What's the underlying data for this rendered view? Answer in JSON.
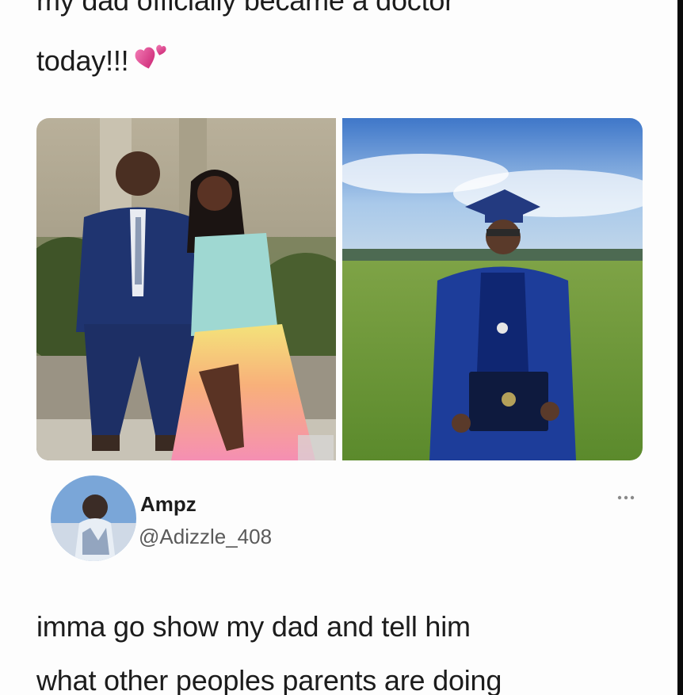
{
  "post": {
    "line1": "my dad officially became a doctor",
    "line2": "today!!!",
    "emoji": "two-hearts-emoji"
  },
  "photos": {
    "left": "father-and-daughter-photo",
    "right": "graduate-in-cap-and-gown-photo"
  },
  "reply": {
    "display_name": "Ampz",
    "handle": "@Adizzle_408",
    "menu": "more-options-icon",
    "line1": "imma go show my dad and tell him",
    "line2": "what other peoples parents are doing"
  },
  "colors": {
    "background": "#fdfdfd",
    "text": "#1c1c1c",
    "handle": "#5a5a5a",
    "heart": "#e0408a"
  }
}
